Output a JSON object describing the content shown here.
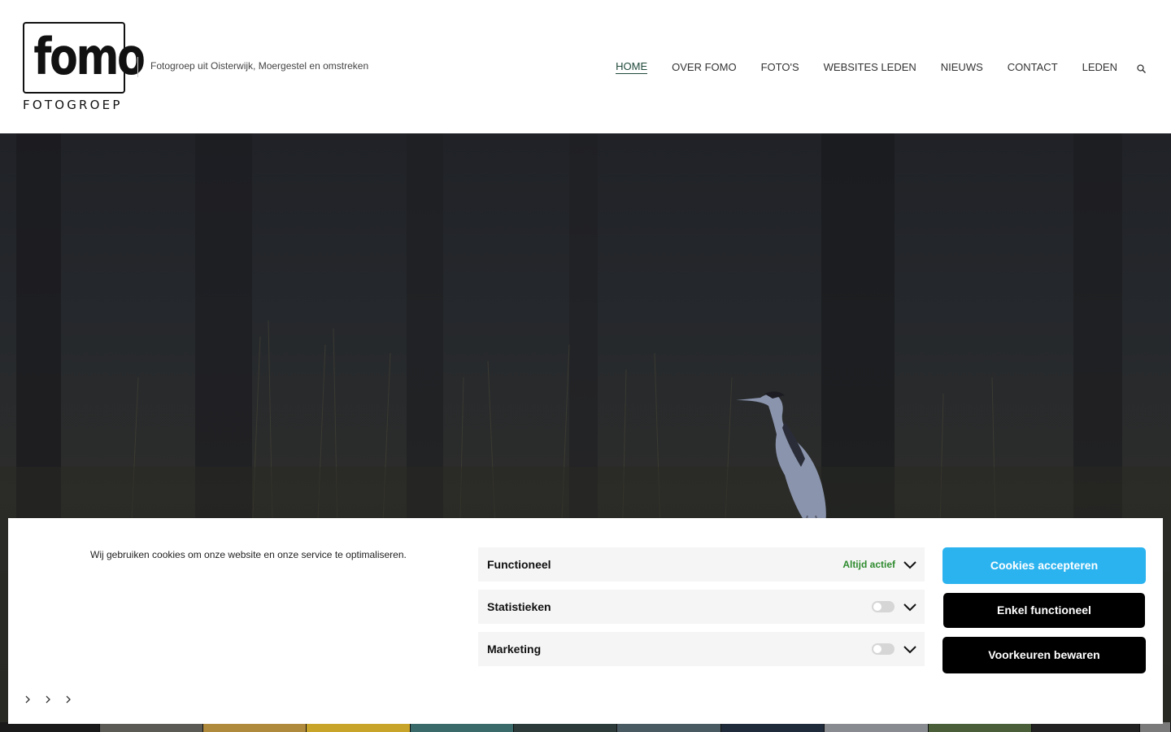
{
  "header": {
    "logo_word": "fomo",
    "logo_sub": "FOTOGROEP",
    "tagline": "Fotogroep uit Oisterwijk, Moergestel en omstreken"
  },
  "nav": {
    "items": [
      {
        "label": "HOME",
        "active": true
      },
      {
        "label": "OVER FOMO"
      },
      {
        "label": "FOTO'S"
      },
      {
        "label": "WEBSITES LEDEN"
      },
      {
        "label": "NIEUWS"
      },
      {
        "label": "CONTACT"
      },
      {
        "label": "LEDEN"
      }
    ],
    "search_icon": "search-icon"
  },
  "cookie": {
    "message": "Wij gebruiken cookies om onze website en onze service te optimaliseren.",
    "preferences": [
      {
        "label": "Functioneel",
        "status": "Altijd actief"
      },
      {
        "label": "Statistieken",
        "toggle": "off"
      },
      {
        "label": "Marketing",
        "toggle": "off"
      }
    ],
    "buttons": {
      "accept": "Cookies accepteren",
      "functional": "Enkel functioneel",
      "save": "Voorkeuren bewaren"
    },
    "links_icon": "chevron-right-icon"
  },
  "colors": {
    "accent": "#2bb3ef",
    "active_nav": "#1f4a3a",
    "always_active": "#2e8b2e"
  }
}
